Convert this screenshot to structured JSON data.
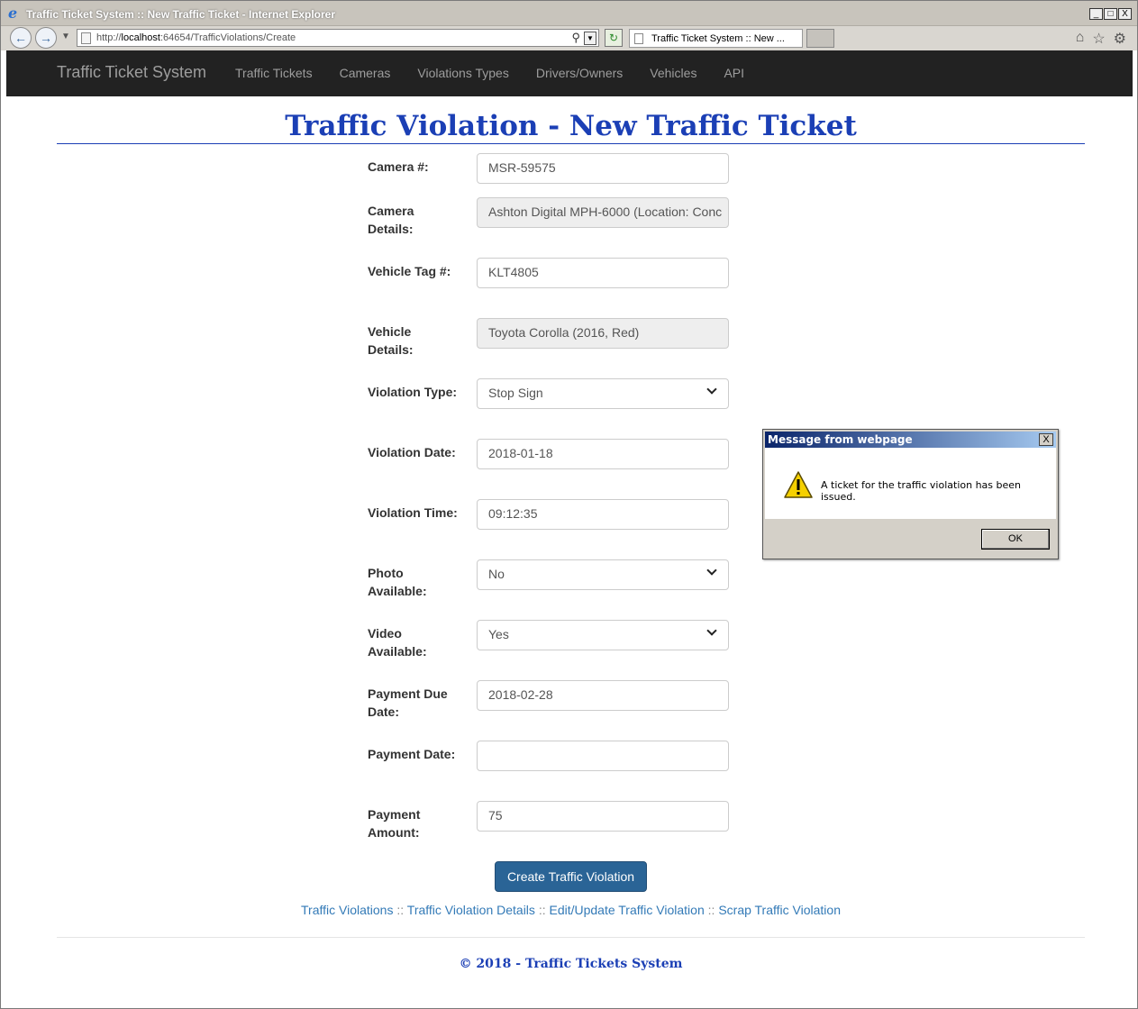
{
  "window": {
    "title": "Traffic Ticket System :: New Traffic Ticket - Internet Explorer",
    "min": "_",
    "max": "□",
    "close": "X"
  },
  "browser": {
    "url_prefix": "http://",
    "url_host": "localhost",
    "url_rest": ":64654/TrafficViolations/Create",
    "tab_label": "Traffic Ticket System :: New ...",
    "tab_close": "×"
  },
  "navbar": {
    "brand": "Traffic Ticket System",
    "links": [
      "Traffic Tickets",
      "Cameras",
      "Violations Types",
      "Drivers/Owners",
      "Vehicles",
      "API"
    ]
  },
  "page": {
    "title": "Traffic Violation - New Traffic Ticket"
  },
  "form": {
    "camera_label": "Camera #:",
    "camera_value": "MSR-59575",
    "camera_details_label": "Camera Details:",
    "camera_details_value": "Ashton Digital MPH-6000 (Location: Conc",
    "vehicle_tag_label": "Vehicle Tag #:",
    "vehicle_tag_value": "KLT4805",
    "vehicle_details_label": "Vehicle Details:",
    "vehicle_details_value": "Toyota Corolla (2016, Red)",
    "violation_type_label": "Violation Type:",
    "violation_type_value": "Stop Sign",
    "violation_date_label": "Violation Date:",
    "violation_date_value": "2018-01-18",
    "violation_time_label": "Violation Time:",
    "violation_time_value": "09:12:35",
    "photo_label": "Photo Available:",
    "photo_value": "No",
    "video_label": "Video Available:",
    "video_value": "Yes",
    "payment_due_label": "Payment Due Date:",
    "payment_due_value": "2018-02-28",
    "payment_date_label": "Payment Date:",
    "payment_date_value": "",
    "payment_amount_label": "Payment Amount:",
    "payment_amount_value": "75",
    "submit_label": "Create Traffic Violation"
  },
  "footer": {
    "links": [
      "Traffic Violations",
      "Traffic Violation Details",
      "Edit/Update Traffic Violation",
      "Scrap Traffic Violation"
    ],
    "separator": "::",
    "copyright": "© 2018 - Traffic Tickets System"
  },
  "dialog": {
    "title": "Message from webpage",
    "message": "A ticket for the traffic violation has been issued.",
    "ok_label": "OK",
    "close": "X"
  },
  "colors": {
    "navbar": "#222222",
    "title": "#1b3fb5",
    "primary_button": "#2a6496",
    "link": "#337ab7"
  }
}
